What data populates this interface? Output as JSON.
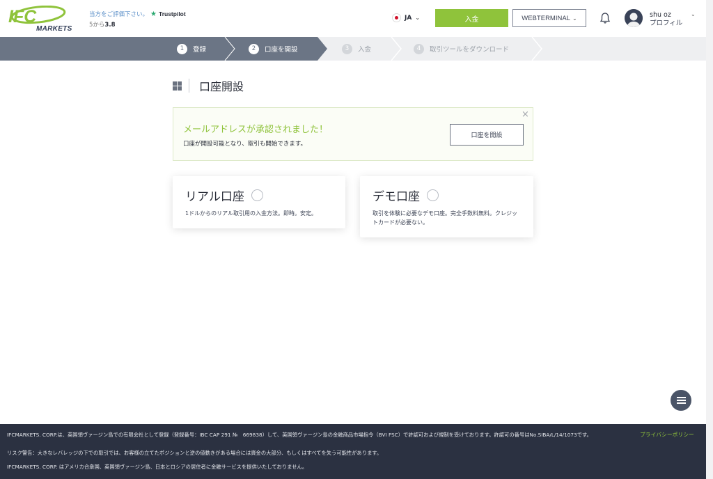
{
  "header": {
    "logo_text": "IFC",
    "logo_sub": "MARKETS",
    "rating_prompt": "当方をご評価下さい。",
    "trustpilot": "Trustpilot",
    "rating_prefix": "5から",
    "rating_value": "3.8",
    "language": "JA",
    "deposit_label": "入金",
    "webterminal_label": "WEBTERMINAL",
    "user_name": "shu oz",
    "profile_label": "プロフィル"
  },
  "steps": [
    {
      "num": "1",
      "label": "登録",
      "state": "active"
    },
    {
      "num": "2",
      "label": "口座を開設",
      "state": "active"
    },
    {
      "num": "3",
      "label": "入金",
      "state": "inactive"
    },
    {
      "num": "4",
      "label": "取引ツールをダウンロード",
      "state": "inactive"
    }
  ],
  "page": {
    "title": "口座開設"
  },
  "notice": {
    "title": "メールアドレスが承認されました！",
    "subtitle": "口座が開設可能となり、取引も開始できます。",
    "open_button": "口座を開設",
    "close": "×"
  },
  "cards": {
    "real": {
      "title": "リアル口座",
      "desc": "1ドルからのリアル取引用の入金方法。即時。安定。"
    },
    "demo": {
      "title": "デモ口座",
      "desc": "取引を体験に必要なデモ口座。完全手数料無料。クレジットカードが必要ない。"
    }
  },
  "footer": {
    "legal": "IFCMARKETS. CORP.は、英国領ヴァージン島での有限会社として登録（登録番号：IBC CAP 291 №　669838）して、英国領ヴァージン島の金融商品市場指令（BVI FSC）で許認可および規制を受けております。許認可の番号はNo.SIBA/L/14/1073です。",
    "warning": "リスク警告：大きなレバレッジの下での取引では、お客様の立てたポジションと逆の値動きがある場合には資金の大部分、もしくはすべてを失う可能性があります。",
    "notice": "IFCMARKETS. CORP. はアメリカ合衆国、英国領ヴァージン島、日本とロシアの居住者に金融サービスを提供いたしておりません。",
    "privacy": "プライバシーポリシー"
  },
  "colors": {
    "brand_green": "#8fc33b",
    "steps_active": "#6b7585",
    "footer_bg": "#2b3141"
  }
}
